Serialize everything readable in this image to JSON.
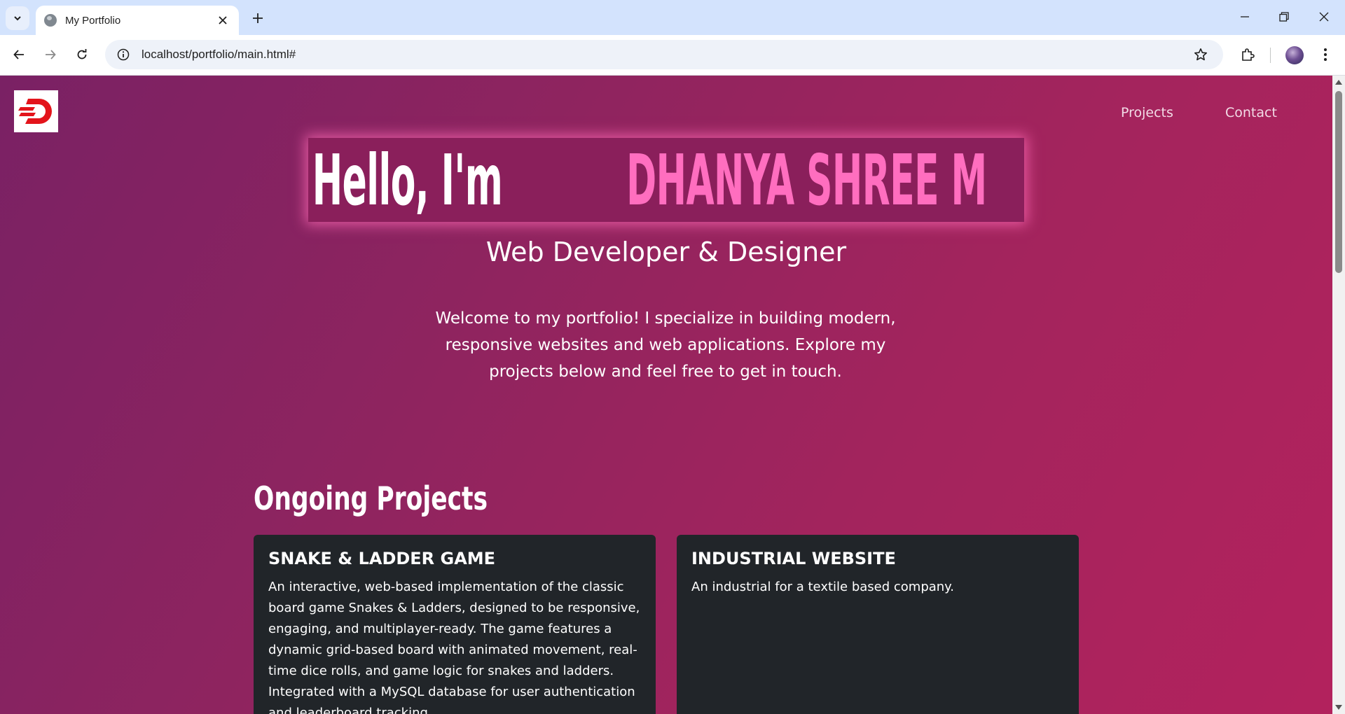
{
  "browser": {
    "tab_title": "My Portfolio",
    "url": "localhost/portfolio/main.html#",
    "icons": [
      "tab-search-icon",
      "globe-icon",
      "close-icon",
      "plus-icon",
      "minimize-icon",
      "restore-icon",
      "window-close-icon",
      "back-arrow-icon",
      "forward-arrow-icon",
      "reload-icon",
      "site-info-icon",
      "star-icon",
      "extensions-icon",
      "kebab-menu-icon"
    ]
  },
  "site": {
    "logo": "D",
    "nav": {
      "projects": "Projects",
      "contact": "Contact"
    }
  },
  "hero": {
    "greeting": "Hello, I'm",
    "name": "DHANYA SHREE M",
    "subtitle": "Web Developer & Designer",
    "intro": "Welcome to my portfolio! I specialize in building modern, responsive websites and web applications. Explore my projects below and feel free to get in touch."
  },
  "projects": {
    "section_title": "Ongoing Projects",
    "items": [
      {
        "title": "SNAKE & LADDER GAME",
        "description": "An interactive, web-based implementation of the classic board game Snakes & Ladders, designed to be responsive, engaging, and multiplayer-ready. The game features a dynamic grid-based board with animated movement, real-time dice rolls, and game logic for snakes and ladders. Integrated with a MySQL database for user authentication and leaderboard tracking."
      },
      {
        "title": "INDUSTRIAL WEBSITE",
        "description": "An industrial for a textile based company."
      }
    ]
  },
  "colors": {
    "accent_pink": "#ff6ebf",
    "card_bg": "#212529",
    "logo_red": "#e3141b"
  }
}
